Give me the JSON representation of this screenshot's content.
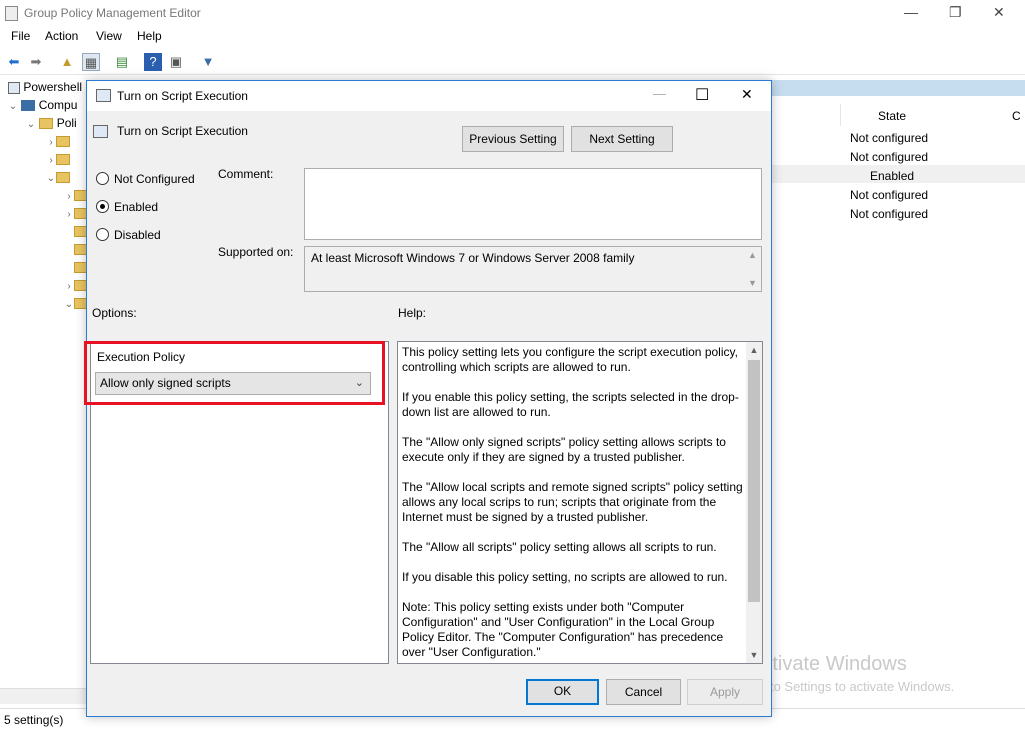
{
  "window": {
    "title": "Group Policy Management Editor",
    "minimize": "—",
    "maximize": "❐",
    "close": "✕"
  },
  "menu": [
    "File",
    "Action",
    "View",
    "Help"
  ],
  "tree": {
    "items": [
      "Powershell",
      "Compu",
      "Poli"
    ]
  },
  "right_pane": {
    "state_header": "State",
    "states": [
      "Not configured",
      "Not configured",
      "Enabled",
      "Not configured",
      "Not configured"
    ]
  },
  "status": "5 setting(s)",
  "watermark": {
    "line1": "Activate Windows",
    "line2": "Go to Settings to activate Windows."
  },
  "dialog": {
    "title": "Turn on Script Execution",
    "setting_name": "Turn on Script Execution",
    "previous_button": "Previous Setting",
    "next_button": "Next Setting",
    "radios": [
      {
        "label": "Not Configured",
        "checked": false
      },
      {
        "label": "Enabled",
        "checked": true
      },
      {
        "label": "Disabled",
        "checked": false
      }
    ],
    "comment_label": "Comment:",
    "comment_value": "",
    "supported_label": "Supported on:",
    "supported_value": "At least Microsoft Windows 7 or Windows Server 2008 family",
    "options_label": "Options:",
    "help_label": "Help:",
    "execution_policy_label": "Execution Policy",
    "execution_policy_value": "Allow only signed scripts",
    "help_paragraphs": [
      "This policy setting lets you configure the script execution policy, controlling which scripts are allowed to run.",
      "If you enable this policy setting, the scripts selected in the drop-down list are allowed to run.",
      "The \"Allow only signed scripts\" policy setting allows scripts to execute only if they are signed by a trusted publisher.",
      "The \"Allow local scripts and remote signed scripts\" policy setting allows any local scrips to run; scripts that originate from the Internet must be signed by a trusted publisher.",
      "The \"Allow all scripts\" policy setting allows all scripts to run.",
      "If you disable this policy setting, no scripts are allowed to run.",
      "Note: This policy setting exists under both \"Computer Configuration\" and \"User Configuration\" in the Local Group Policy Editor. The \"Computer Configuration\" has precedence over \"User Configuration.\""
    ],
    "ok_button": "OK",
    "cancel_button": "Cancel",
    "apply_button": "Apply",
    "minimize": "—",
    "maximize": "☐",
    "close": "✕"
  },
  "colors": {
    "highlight": "#e81123",
    "accent": "#0078d7"
  }
}
